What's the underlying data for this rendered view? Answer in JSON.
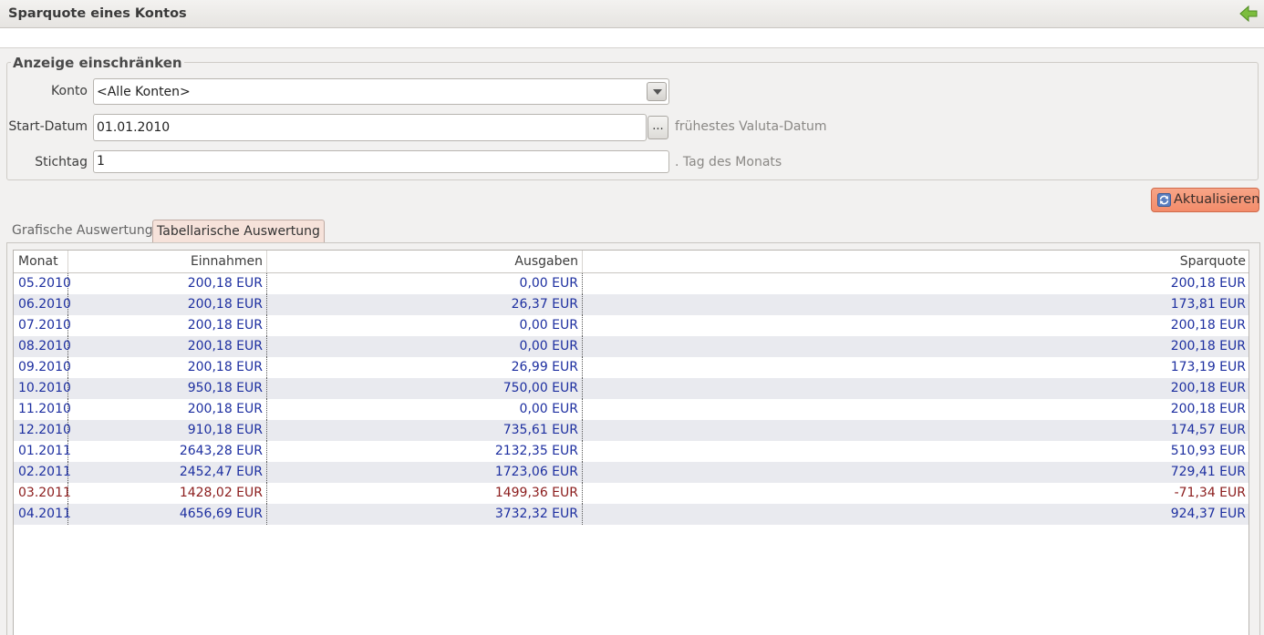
{
  "window": {
    "title": "Sparquote eines Kontos",
    "back_icon": "green-back-arrow-icon"
  },
  "filter": {
    "group_title": "Anzeige einschränken",
    "konto_label": "Konto",
    "konto_value": "<Alle Konten>",
    "start_label": "Start-Datum",
    "start_value": "01.01.2010",
    "start_button": "...",
    "start_hint": "frühestes Valuta-Datum",
    "stichtag_label": "Stichtag",
    "stichtag_value": "1",
    "stichtag_hint": ". Tag des Monats"
  },
  "refresh_button": "Aktualisieren",
  "tabs": [
    {
      "label": "Grafische Auswertung",
      "active": false
    },
    {
      "label": "Tabellarische Auswertung",
      "active": true
    }
  ],
  "table": {
    "headers": [
      "Monat",
      "Einnahmen",
      "Ausgaben",
      "Sparquote"
    ],
    "rows": [
      {
        "monat": "05.2010",
        "einnahmen": "200,18 EUR",
        "ausgaben": "0,00 EUR",
        "sparquote": "200,18 EUR",
        "negative": false
      },
      {
        "monat": "06.2010",
        "einnahmen": "200,18 EUR",
        "ausgaben": "26,37 EUR",
        "sparquote": "173,81 EUR",
        "negative": false
      },
      {
        "monat": "07.2010",
        "einnahmen": "200,18 EUR",
        "ausgaben": "0,00 EUR",
        "sparquote": "200,18 EUR",
        "negative": false
      },
      {
        "monat": "08.2010",
        "einnahmen": "200,18 EUR",
        "ausgaben": "0,00 EUR",
        "sparquote": "200,18 EUR",
        "negative": false
      },
      {
        "monat": "09.2010",
        "einnahmen": "200,18 EUR",
        "ausgaben": "26,99 EUR",
        "sparquote": "173,19 EUR",
        "negative": false
      },
      {
        "monat": "10.2010",
        "einnahmen": "950,18 EUR",
        "ausgaben": "750,00 EUR",
        "sparquote": "200,18 EUR",
        "negative": false
      },
      {
        "monat": "11.2010",
        "einnahmen": "200,18 EUR",
        "ausgaben": "0,00 EUR",
        "sparquote": "200,18 EUR",
        "negative": false
      },
      {
        "monat": "12.2010",
        "einnahmen": "910,18 EUR",
        "ausgaben": "735,61 EUR",
        "sparquote": "174,57 EUR",
        "negative": false
      },
      {
        "monat": "01.2011",
        "einnahmen": "2643,28 EUR",
        "ausgaben": "2132,35 EUR",
        "sparquote": "510,93 EUR",
        "negative": false
      },
      {
        "monat": "02.2011",
        "einnahmen": "2452,47 EUR",
        "ausgaben": "1723,06 EUR",
        "sparquote": "729,41 EUR",
        "negative": false
      },
      {
        "monat": "03.2011",
        "einnahmen": "1428,02 EUR",
        "ausgaben": "1499,36 EUR",
        "sparquote": "-71,34 EUR",
        "negative": true
      },
      {
        "monat": "04.2011",
        "einnahmen": "4656,69 EUR",
        "ausgaben": "3732,32 EUR",
        "sparquote": "924,37 EUR",
        "negative": false
      }
    ]
  },
  "colors": {
    "positive": "#1d2fa0",
    "negative": "#8b1c1c",
    "accent": "#f38c6a"
  }
}
